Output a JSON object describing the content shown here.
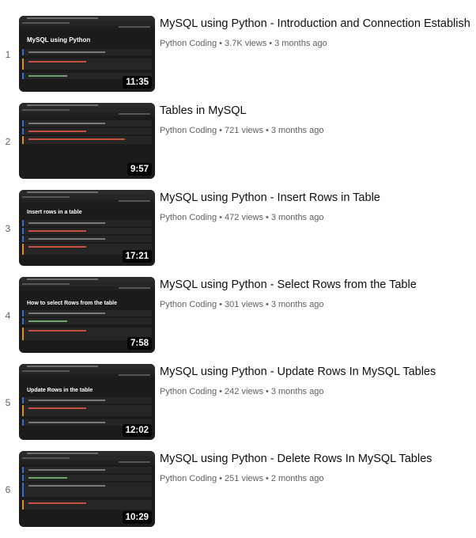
{
  "playlist": {
    "items": [
      {
        "index": "1",
        "title": "MySQL using Python - Introduction and Connection Establish",
        "channel": "Python Coding",
        "views": "3.7K views",
        "age": "3 months ago",
        "duration": "11:35",
        "slide_title": "MySQL using Python"
      },
      {
        "index": "2",
        "title": "Tables in MySQL",
        "channel": "Python Coding",
        "views": "721 views",
        "age": "3 months ago",
        "duration": "9:57",
        "slide_title": ""
      },
      {
        "index": "3",
        "title": "MySQL using Python - Insert Rows in Table",
        "channel": "Python Coding",
        "views": "472 views",
        "age": "3 months ago",
        "duration": "17:21",
        "slide_title": "Insert rows in a table"
      },
      {
        "index": "4",
        "title": "MySQL using Python - Select Rows from the Table",
        "channel": "Python Coding",
        "views": "301 views",
        "age": "3 months ago",
        "duration": "7:58",
        "slide_title": "How to select Rows from the table"
      },
      {
        "index": "5",
        "title": "MySQL using Python - Update Rows In MySQL Tables",
        "channel": "Python Coding",
        "views": "242 views",
        "age": "3 months ago",
        "duration": "12:02",
        "slide_title": "Update Rows in the table"
      },
      {
        "index": "6",
        "title": "MySQL using Python - Delete Rows In MySQL Tables",
        "channel": "Python Coding",
        "views": "251 views",
        "age": "2 months ago",
        "duration": "10:29",
        "slide_title": ""
      }
    ],
    "separator": "•"
  }
}
